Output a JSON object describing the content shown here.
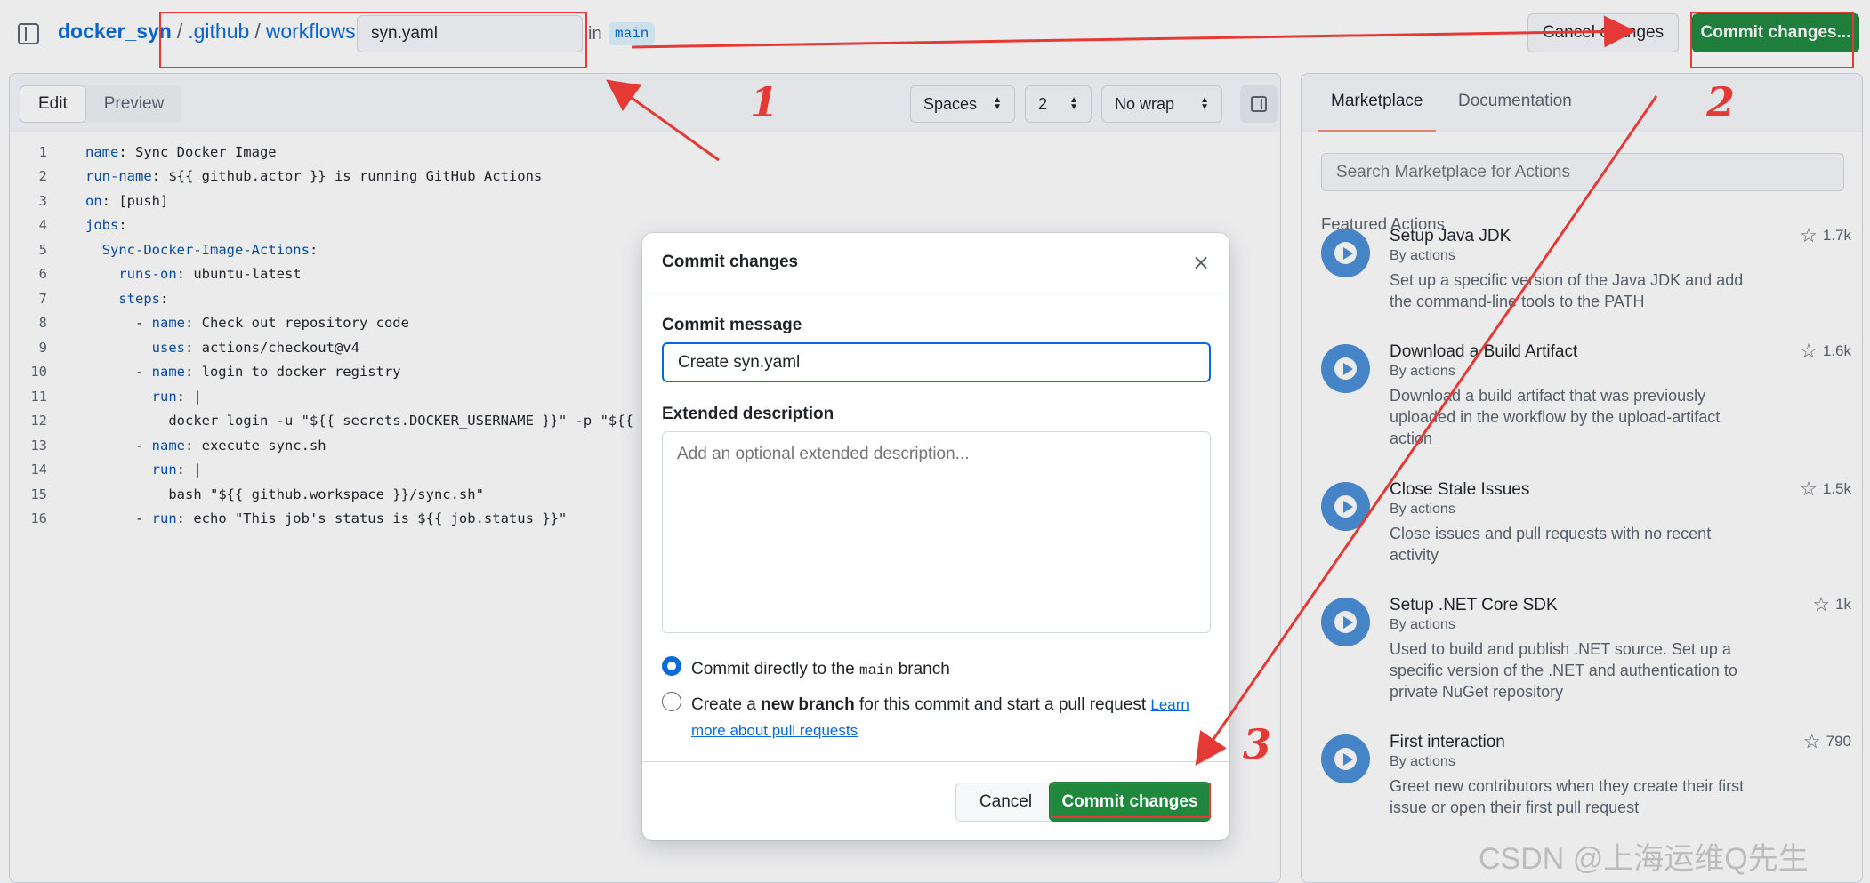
{
  "breadcrumb": {
    "repo": "docker_syn",
    "sep": "/",
    "parts": [
      ".github",
      "workflows"
    ],
    "filename": "syn.yaml",
    "in_text": "in",
    "branch": "main"
  },
  "header_buttons": {
    "cancel": "Cancel changes",
    "commit": "Commit changes..."
  },
  "editor": {
    "tabs": [
      "Edit",
      "Preview"
    ],
    "indent_mode": "Spaces",
    "indent_size": "2",
    "wrap_mode": "No wrap",
    "lines": [
      {
        "n": "1",
        "indent": "",
        "key": "name",
        "rest": ": Sync Docker Image"
      },
      {
        "n": "2",
        "indent": "",
        "key": "run-name",
        "rest": ": ${{ github.actor }} is running GitHub Actions"
      },
      {
        "n": "3",
        "indent": "",
        "key": "on",
        "rest": ": [push]"
      },
      {
        "n": "4",
        "indent": "",
        "key": "jobs",
        "rest": ":"
      },
      {
        "n": "5",
        "indent": "  ",
        "key": "Sync-Docker-Image-Actions",
        "rest": ":"
      },
      {
        "n": "6",
        "indent": "    ",
        "key": "runs-on",
        "rest": ": ubuntu-latest"
      },
      {
        "n": "7",
        "indent": "    ",
        "key": "steps",
        "rest": ":"
      },
      {
        "n": "8",
        "indent": "      - ",
        "key": "name",
        "rest": ": Check out repository code"
      },
      {
        "n": "9",
        "indent": "        ",
        "key": "uses",
        "rest": ": actions/checkout@v4"
      },
      {
        "n": "10",
        "indent": "      - ",
        "key": "name",
        "rest": ": login to docker registry"
      },
      {
        "n": "11",
        "indent": "        ",
        "key": "run",
        "rest": ": |"
      },
      {
        "n": "12",
        "indent": "          ",
        "key": "",
        "rest": "docker login -u \"${{ secrets.DOCKER_USERNAME }}\" -p \"${{ se"
      },
      {
        "n": "13",
        "indent": "      - ",
        "key": "name",
        "rest": ": execute sync.sh"
      },
      {
        "n": "14",
        "indent": "        ",
        "key": "run",
        "rest": ": |"
      },
      {
        "n": "15",
        "indent": "          ",
        "key": "",
        "rest": "bash \"${{ github.workspace }}/sync.sh\""
      },
      {
        "n": "16",
        "indent": "      - ",
        "key": "run",
        "rest": ": echo \"This job's status is ${{ job.status }}\""
      }
    ]
  },
  "sidebar": {
    "tabs": [
      "Marketplace",
      "Documentation"
    ],
    "search_placeholder": "Search Marketplace for Actions",
    "featured_heading": "Featured Actions",
    "actions": [
      {
        "title": "Setup Java JDK",
        "by": "By actions",
        "desc": "Set up a specific version of the Java JDK and add the command-line tools to the PATH",
        "stars": "1.7k"
      },
      {
        "title": "Download a Build Artifact",
        "by": "By actions",
        "desc": "Download a build artifact that was previously uploaded in the workflow by the upload-artifact action",
        "stars": "1.6k"
      },
      {
        "title": "Close Stale Issues",
        "by": "By actions",
        "desc": "Close issues and pull requests with no recent activity",
        "stars": "1.5k"
      },
      {
        "title": "Setup .NET Core SDK",
        "by": "By actions",
        "desc": "Used to build and publish .NET source. Set up a specific version of the .NET and authentication to private NuGet repository",
        "stars": "1k"
      },
      {
        "title": "First interaction",
        "by": "By actions",
        "desc": "Greet new contributors when they create their first issue or open their first pull request",
        "stars": "790"
      }
    ]
  },
  "dialog": {
    "title": "Commit changes",
    "close_symbol": "×",
    "message_label": "Commit message",
    "message_value": "Create syn.yaml",
    "description_label": "Extended description",
    "description_placeholder": "Add an optional extended description...",
    "option_direct": {
      "prefix": "Commit directly to the",
      "branch": "main",
      "suffix": "branch"
    },
    "option_new": {
      "prefix": "Create a",
      "bold": "new branch",
      "suffix": "for this commit and start a pull request",
      "link": "Learn more about pull requests"
    },
    "cancel": "Cancel",
    "commit": "Commit changes"
  },
  "annotations": {
    "numbers": [
      "1",
      "2",
      "3"
    ],
    "color": "#e53935"
  },
  "watermark": "CSDN @上海运维Q先生",
  "colors": {
    "accent": "#0969da",
    "primary_button": "#1f883d",
    "annotation": "#e53935"
  }
}
